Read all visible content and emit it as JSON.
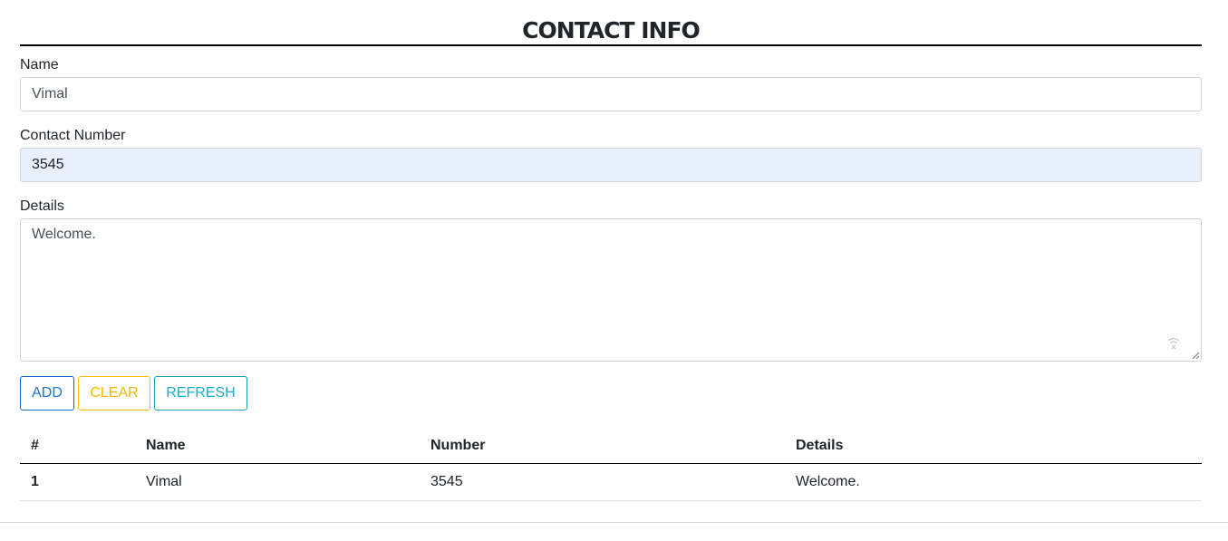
{
  "header": {
    "title": "CONTACT INFO"
  },
  "form": {
    "name": {
      "label": "Name",
      "value": "Vimal"
    },
    "number": {
      "label": "Contact Number",
      "value": "3545"
    },
    "details": {
      "label": "Details",
      "value": "Welcome."
    }
  },
  "buttons": {
    "add": "ADD",
    "clear": "CLEAR",
    "refresh": "REFRESH"
  },
  "table": {
    "columns": [
      "#",
      "Name",
      "Number",
      "Details"
    ],
    "rows": [
      {
        "index": "1",
        "name": "Vimal",
        "number": "3545",
        "details": "Welcome."
      }
    ]
  },
  "colors": {
    "add": "#1976d2",
    "clear": "#f5b800",
    "refresh": "#17b0c8",
    "autofill_bg": "#e8f0fe"
  }
}
